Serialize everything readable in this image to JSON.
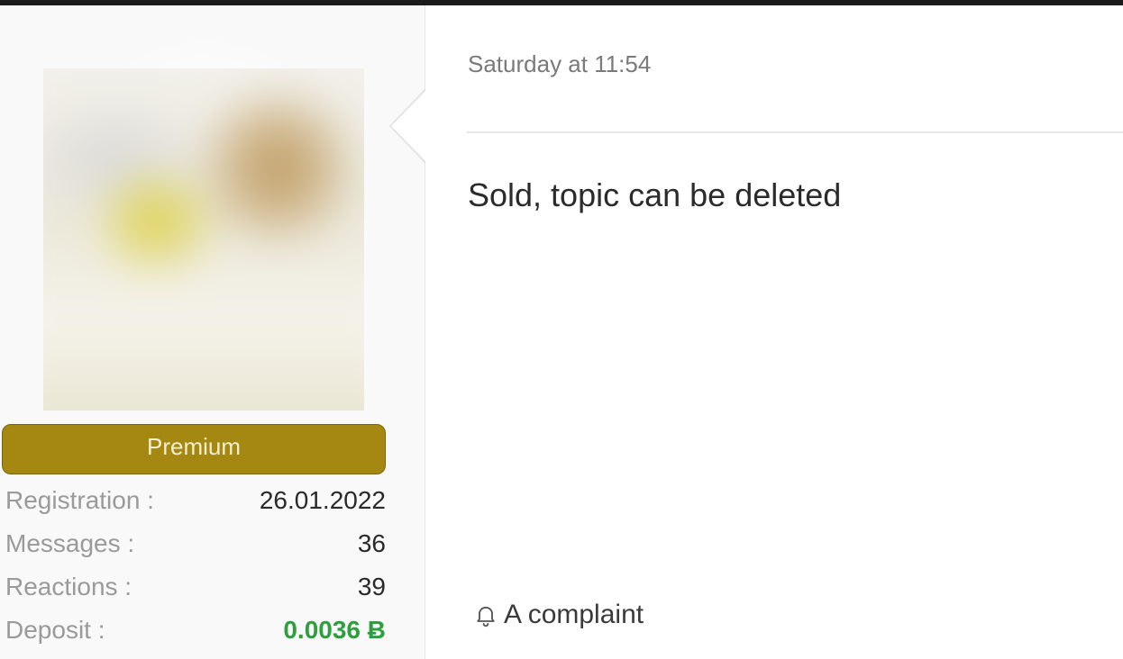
{
  "user": {
    "badge": "Premium",
    "stats": [
      {
        "label": "Registration :",
        "value": "26.01.2022"
      },
      {
        "label": "Messages :",
        "value": "36"
      },
      {
        "label": "Reactions :",
        "value": "39"
      },
      {
        "label": "Deposit :",
        "value": "0.0036 Ƀ"
      }
    ]
  },
  "post": {
    "date": "Saturday at 11:54",
    "body": "Sold, topic can be deleted",
    "complaint_label": "A complaint"
  },
  "icons": {
    "complaint": "bell-icon"
  },
  "colors": {
    "badge": "#a48812",
    "deposit": "#2f9e3f"
  }
}
